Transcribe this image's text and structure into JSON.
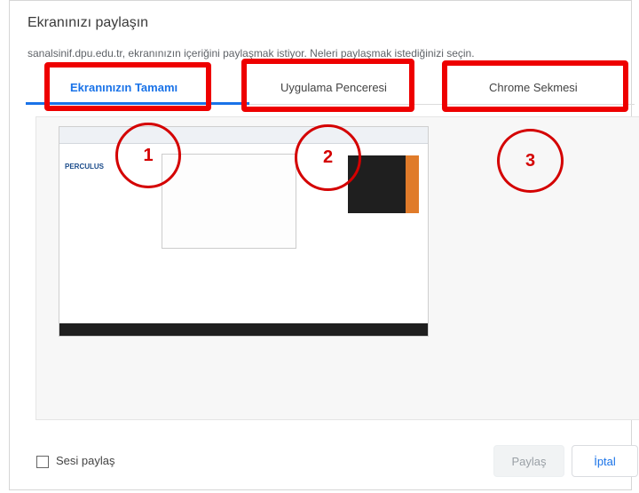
{
  "dialog": {
    "title": "Ekranınızı paylaşın",
    "subtitle": "sanalsinif.dpu.edu.tr, ekranınızın içeriğini paylaşmak istiyor. Neleri paylaşmak istediğinizi seçin.",
    "tabs": [
      {
        "label": "Ekranınızın Tamamı",
        "active": true,
        "marker": "1"
      },
      {
        "label": "Uygulama Penceresi",
        "active": false,
        "marker": "2"
      },
      {
        "label": "Chrome Sekmesi",
        "active": false,
        "marker": "3"
      }
    ],
    "preview": {
      "logo_text": "PERCULUS"
    },
    "footer": {
      "share_audio_label": "Sesi paylaş",
      "share_button": "Paylaş",
      "cancel_button": "İptal"
    }
  },
  "colors": {
    "accent": "#1a73e8",
    "annotation_red": "#ee0000"
  }
}
